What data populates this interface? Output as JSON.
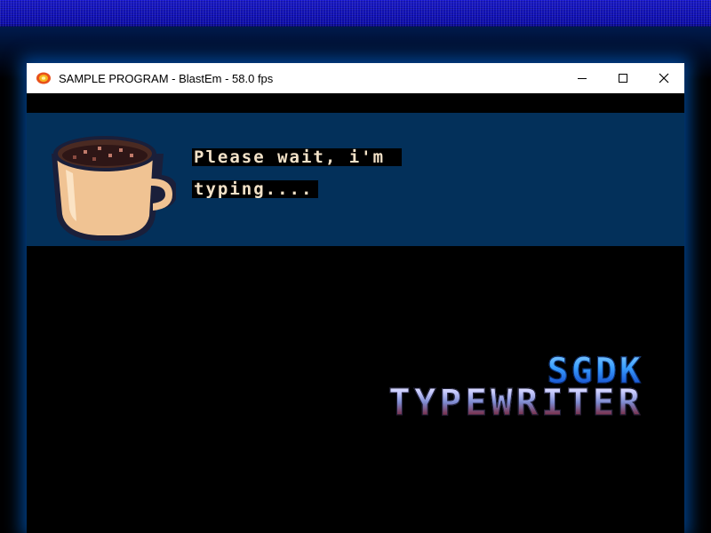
{
  "window": {
    "title": "SAMPLE PROGRAM - BlastEm - 58.0 fps",
    "app_icon": "blastem-icon",
    "controls": {
      "minimize": "minimize-icon",
      "maximize": "maximize-icon",
      "close": "close-icon"
    }
  },
  "dialog": {
    "portrait": "coffee-cup-icon",
    "line1": "Please wait, i'm ",
    "line2": "typing...."
  },
  "logo": {
    "line1": "SGDK",
    "line2": "TYPEWRITER"
  },
  "colors": {
    "dialog_bg": "#03305a",
    "text": "#f3e2c8",
    "glow": "#0078ff"
  }
}
